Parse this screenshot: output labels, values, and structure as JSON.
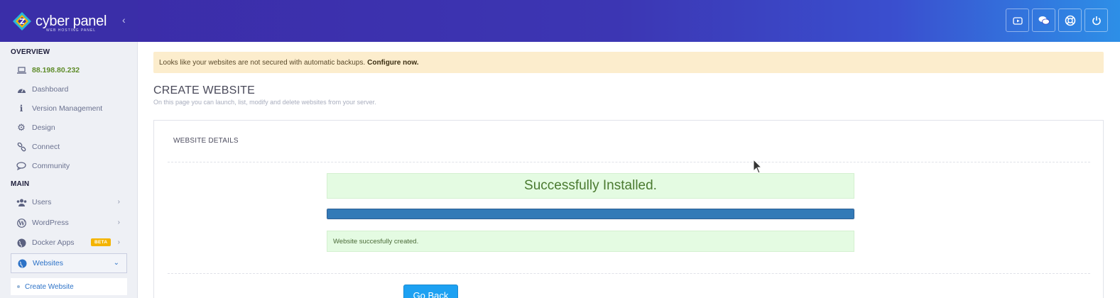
{
  "brand": {
    "name": "cyber panel",
    "tagline": "WEB HOSTING PANEL",
    "colors": {
      "header_start": "#3b2aa6",
      "header_end": "#2d8fe7",
      "accent": "#2c72c7",
      "success": "#4a7a30"
    }
  },
  "header": {
    "icons": [
      "youtube-icon",
      "chat-icon",
      "support-icon",
      "power-icon"
    ]
  },
  "sidebar": {
    "overview_title": "OVERVIEW",
    "ip": "88.198.80.232",
    "overview_items": [
      {
        "label": "Dashboard",
        "icon": "dashboard-icon"
      },
      {
        "label": "Version Management",
        "icon": "info-icon"
      },
      {
        "label": "Design",
        "icon": "gear-icon"
      },
      {
        "label": "Connect",
        "icon": "link-icon"
      },
      {
        "label": "Community",
        "icon": "comments-icon"
      }
    ],
    "main_title": "MAIN",
    "main_items": [
      {
        "label": "Users",
        "icon": "users-icon"
      },
      {
        "label": "WordPress",
        "icon": "wordpress-icon"
      },
      {
        "label": "Docker Apps",
        "icon": "globe-icon",
        "badge": "BETA"
      },
      {
        "label": "Websites",
        "icon": "globe-icon"
      }
    ],
    "sub_item": "Create Website"
  },
  "alert": {
    "text": "Looks like your websites are not secured with automatic backups.",
    "link": "Configure now."
  },
  "page": {
    "title": "CREATE WEBSITE",
    "subtitle": "On this page you can launch, list, modify and delete websites from your server."
  },
  "panel": {
    "title": "WEBSITE DETAILS",
    "status": "Successfully Installed.",
    "progress_percent": 100,
    "message": "Website succesfully created.",
    "button": "Go Back"
  }
}
